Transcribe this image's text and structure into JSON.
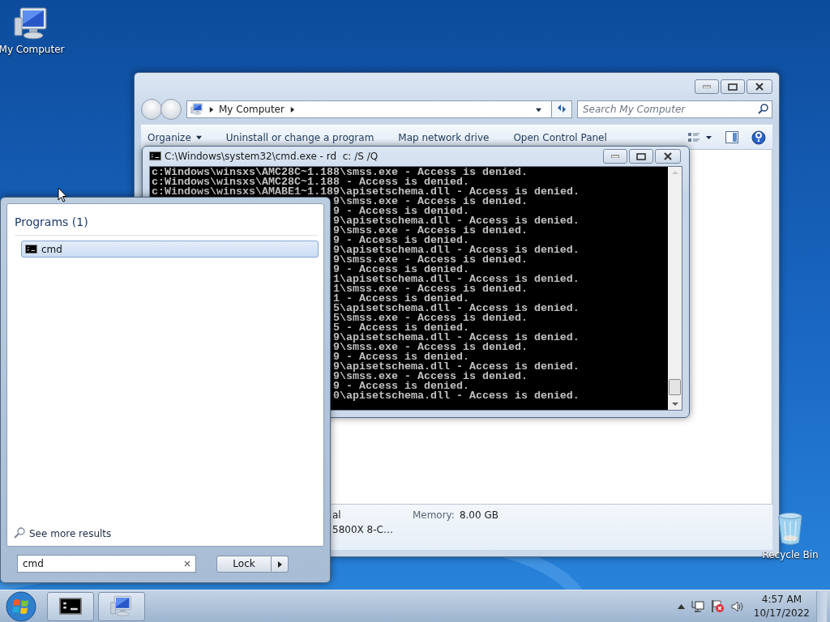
{
  "desktop_icons": [
    {
      "kind": "computer",
      "label": "My Computer"
    },
    {
      "kind": "trash",
      "label": "Recycle Bin"
    }
  ],
  "explorer": {
    "breadcrumb": "My Computer",
    "search": {
      "placeholder": "Search My Computer"
    },
    "toolbar": [
      {
        "label": "Organize",
        "dropdown": true
      },
      {
        "label": "Uninstall or change a program",
        "dropdown": false
      },
      {
        "label": "Map network drive",
        "dropdown": false
      },
      {
        "label": "Open Control Panel",
        "dropdown": false
      }
    ],
    "details": {
      "column_1": [
        "al",
        "5800X 8-C…"
      ],
      "memory_label": "Memory:",
      "memory_value": "8.00 GB"
    }
  },
  "console": {
    "title": "C:\\Windows\\system32\\cmd.exe - rd  c: /S /Q",
    "lines": [
      {
        "kind": "full",
        "text": "c:Windows\\winsxs\\AMC28C~1.188\\smss.exe - Access is denied."
      },
      {
        "kind": "full",
        "text": "c:Windows\\winsxs\\AMC28C~1.188 - Access is denied."
      },
      {
        "kind": "full",
        "text": "c:Windows\\winsxs\\AMABE1~1.189\\apisetschema.dll - Access is denied."
      },
      {
        "kind": "tail",
        "text": "9\\smss.exe - Access is denied."
      },
      {
        "kind": "tail",
        "text": "9 - Access is denied."
      },
      {
        "kind": "tail",
        "text": "9\\apisetschema.dll - Access is denied."
      },
      {
        "kind": "tail",
        "text": "9\\smss.exe - Access is denied."
      },
      {
        "kind": "tail",
        "text": "9 - Access is denied."
      },
      {
        "kind": "tail",
        "text": "9\\apisetschema.dll - Access is denied."
      },
      {
        "kind": "tail",
        "text": "9\\smss.exe - Access is denied."
      },
      {
        "kind": "tail",
        "text": "9 - Access is denied."
      },
      {
        "kind": "tail",
        "text": "1\\apisetschema.dll - Access is denied."
      },
      {
        "kind": "tail",
        "text": "1\\smss.exe - Access is denied."
      },
      {
        "kind": "tail",
        "text": "1 - Access is denied."
      },
      {
        "kind": "tail",
        "text": "5\\apisetschema.dll - Access is denied."
      },
      {
        "kind": "tail",
        "text": "5\\smss.exe - Access is denied."
      },
      {
        "kind": "tail",
        "text": "5 - Access is denied."
      },
      {
        "kind": "tail",
        "text": "9\\apisetschema.dll - Access is denied."
      },
      {
        "kind": "tail",
        "text": "9\\smss.exe - Access is denied."
      },
      {
        "kind": "tail",
        "text": "9 - Access is denied."
      },
      {
        "kind": "tail",
        "text": "9\\apisetschema.dll - Access is denied."
      },
      {
        "kind": "tail",
        "text": "9\\smss.exe - Access is denied."
      },
      {
        "kind": "tail",
        "text": "9 - Access is denied."
      },
      {
        "kind": "tail",
        "text": "0\\apisetschema.dll - Access is denied."
      }
    ]
  },
  "start_menu": {
    "heading": "Programs (1)",
    "results": [
      {
        "label": "cmd",
        "selected": true
      }
    ],
    "see_more": "See more results",
    "search": {
      "value": "cmd"
    },
    "power_button": "Lock"
  },
  "taskbar": {
    "buttons": [
      {
        "kind": "console"
      },
      {
        "kind": "computer"
      }
    ],
    "time": "4:57 AM",
    "date": "10/17/2022"
  }
}
